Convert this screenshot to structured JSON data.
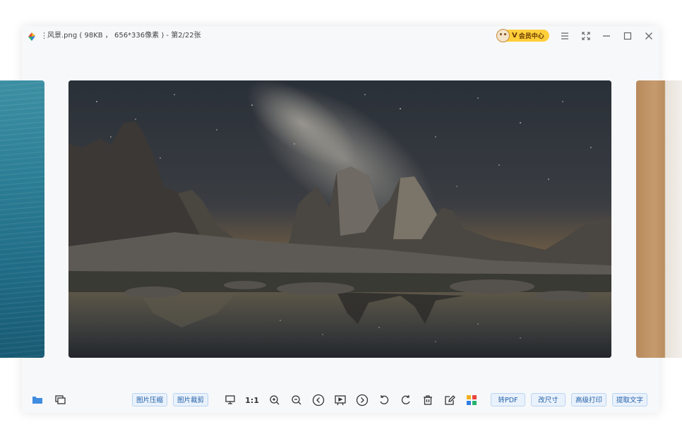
{
  "window": {
    "title": "风景.png ( 98KB ， 656*336像素 ) - 第2/22张",
    "vip_badge": {
      "prefix": "V",
      "label": "会员中心"
    },
    "controls": [
      "menu-icon",
      "fullscreen-icon",
      "minimize-icon",
      "maximize-icon",
      "close-icon"
    ]
  },
  "gallery": {
    "current_index": 2,
    "total": 22,
    "images": [
      "turquoise-water",
      "dolomites-milky-way-night",
      "wooden-interior"
    ]
  },
  "toolbar": {
    "left_icons": [
      "folder-icon",
      "copy-images-icon"
    ],
    "tool_buttons": {
      "compress": "图片压缩",
      "crop": "图片裁剪"
    },
    "view_icons": [
      "monitor-icon",
      "actual-size-icon",
      "zoom-in-icon",
      "zoom-out-icon",
      "prev-icon",
      "slideshow-icon",
      "next-icon",
      "rotate-left-icon",
      "rotate-right-icon",
      "delete-icon",
      "edit-icon",
      "apps-icon"
    ],
    "action_buttons": {
      "to_pdf": "转PDF",
      "resize": "改尺寸",
      "print": "高级打印",
      "ocr": "提取文字"
    }
  },
  "colors": {
    "accent": "#2560a8",
    "button_bg": "#e9f2fc",
    "vip_gold": "#ffcf3a"
  }
}
